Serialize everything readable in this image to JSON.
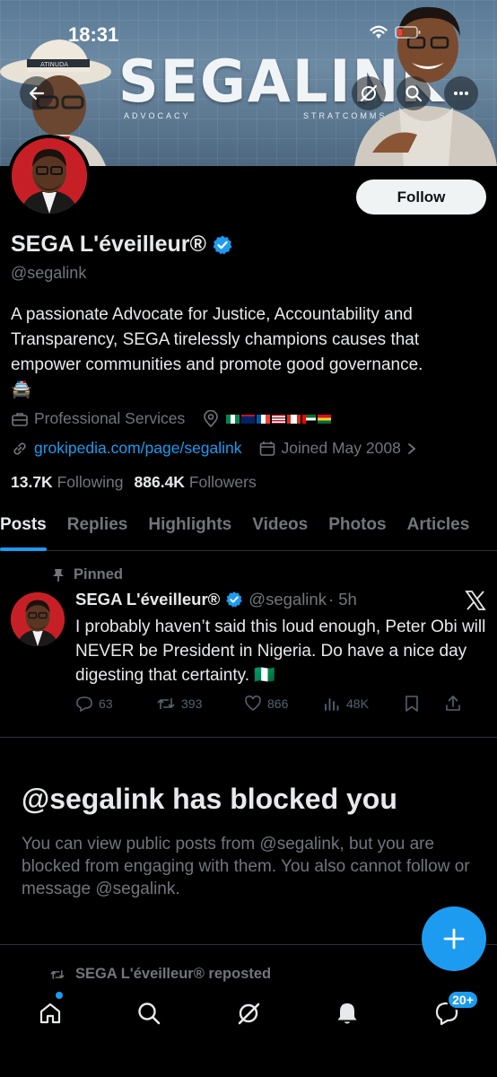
{
  "status": {
    "time": "18:31"
  },
  "banner": {
    "title": "SEGALINK",
    "sub_left": "ADVOCACY",
    "sub_right": "STRATCOMMS",
    "hat_text": "ATINUDA"
  },
  "profile": {
    "follow_label": "Follow",
    "display_name": "SEGA L'éveilleur®",
    "handle": "@segalink",
    "bio": "A passionate Advocate for Justice, Accountability and Transparency, SEGA tirelessly champions causes that empower communities and promote good governance.",
    "bio_emoji": "🚔",
    "category": "Professional Services",
    "website": "grokipedia.com/page/segalink",
    "joined": "Joined May 2008",
    "following_count": "13.7K",
    "following_label": "Following",
    "followers_count": "886.4K",
    "followers_label": "Followers"
  },
  "tabs": [
    "Posts",
    "Replies",
    "Highlights",
    "Videos",
    "Photos",
    "Articles"
  ],
  "post": {
    "pinned_label": "Pinned",
    "author": "SEGA L'éveilleur®",
    "handle": "@segalink",
    "time": "· 5h",
    "text": "I probably haven’t said this loud enough, Peter Obi will NEVER be President in Nigeria. Do have a nice day digesting that certainty. 🇳🇬",
    "replies": "63",
    "reposts": "393",
    "likes": "866",
    "views": "48K"
  },
  "blocked": {
    "title": "@segalink has blocked you",
    "text": "You can view public posts from @segalink, but you are blocked from engaging with them. You also cannot follow or message @segalink."
  },
  "reposted_label": "SEGA L'éveilleur® reposted",
  "nav": {
    "messages_badge": "20+"
  },
  "colors": {
    "accent": "#1d9bf0",
    "background": "#000000",
    "muted": "#71767b"
  }
}
